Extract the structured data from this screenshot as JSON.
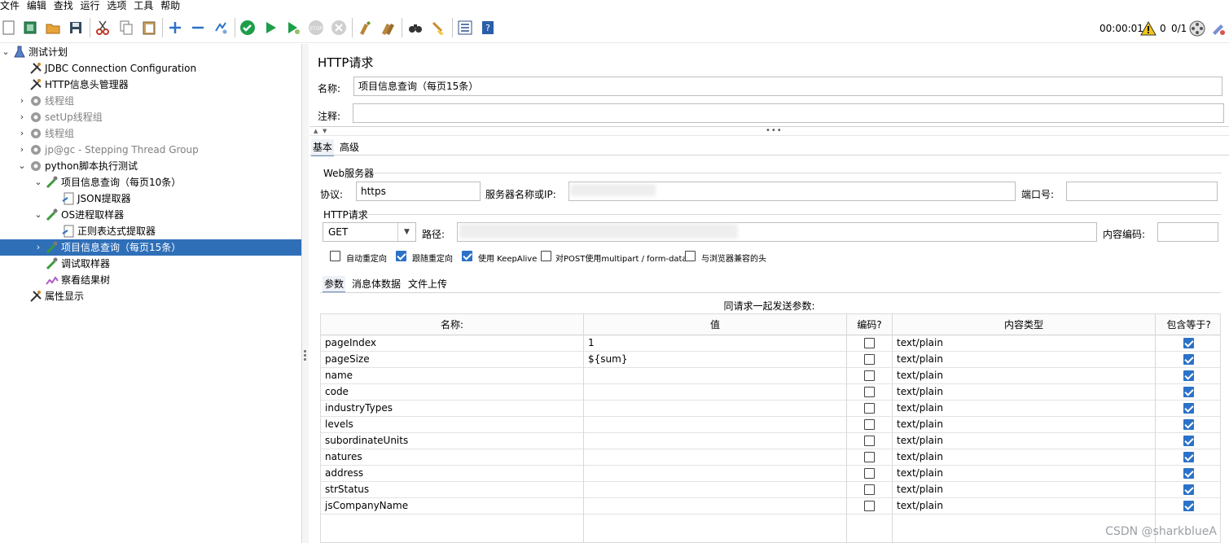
{
  "menu": [
    "文件",
    "编辑",
    "查找",
    "运行",
    "选项",
    "工具",
    "帮助"
  ],
  "toolbar": {
    "icons": [
      "new-icon",
      "templates-icon",
      "open-icon",
      "save-icon",
      "cut-icon",
      "copy-icon",
      "paste-icon",
      "expand-icon",
      "collapse-icon",
      "toggle-icon",
      "start-icon",
      "start-no-pause-icon",
      "stop-icon",
      "shutdown-icon",
      "clear-icon",
      "clear-all-icon",
      "search-icon",
      "reset-search-icon",
      "function-helper-icon",
      "help-icon"
    ],
    "timer": "00:00:01",
    "warnings": "0",
    "threads": "0/1"
  },
  "tree": [
    {
      "label": "测试计划",
      "icon": "test-plan-icon",
      "expanded": true,
      "disabled": false,
      "selected": false
    },
    {
      "label": "JDBC Connection Configuration",
      "icon": "config-icon",
      "disabled": false,
      "selected": false
    },
    {
      "label": "HTTP信息头管理器",
      "icon": "config-icon",
      "disabled": false,
      "selected": false
    },
    {
      "label": "线程组",
      "icon": "thread-group-icon",
      "disabled": true,
      "selected": false
    },
    {
      "label": "setUp线程组",
      "icon": "thread-group-icon",
      "disabled": true,
      "selected": false
    },
    {
      "label": "线程组",
      "icon": "thread-group-icon",
      "disabled": true,
      "selected": false
    },
    {
      "label": "jp@gc - Stepping Thread Group",
      "icon": "thread-group-icon",
      "disabled": true,
      "selected": false
    },
    {
      "label": "python脚本执行测试",
      "icon": "thread-group-icon",
      "disabled": false,
      "selected": false
    },
    {
      "label": "项目信息查询（每页10条）",
      "icon": "sampler-icon",
      "disabled": false,
      "selected": false
    },
    {
      "label": "JSON提取器",
      "icon": "extractor-icon",
      "disabled": false,
      "selected": false
    },
    {
      "label": "OS进程取样器",
      "icon": "sampler-icon",
      "disabled": false,
      "selected": false
    },
    {
      "label": "正则表达式提取器",
      "icon": "extractor-icon",
      "disabled": false,
      "selected": false
    },
    {
      "label": "项目信息查询（每页15条）",
      "icon": "sampler-icon",
      "disabled": false,
      "selected": true
    },
    {
      "label": "调试取样器",
      "icon": "sampler-icon",
      "disabled": false,
      "selected": false
    },
    {
      "label": "察看结果树",
      "icon": "listener-icon",
      "disabled": false,
      "selected": false
    },
    {
      "label": "属性显示",
      "icon": "config-icon",
      "disabled": false,
      "selected": false
    }
  ],
  "panel": {
    "title": "HTTP请求",
    "name_label": "名称:",
    "name_value": "项目信息查询（每页15条）",
    "comment_label": "注释:",
    "comment_value": "",
    "tabs": [
      "基本",
      "高级"
    ],
    "web_server": {
      "title": "Web服务器",
      "protocol_label": "协议:",
      "protocol_value": "https",
      "server_label": "服务器名称或IP:",
      "port_label": "端口号:",
      "port_value": ""
    },
    "http_request": {
      "title": "HTTP请求",
      "method": "GET",
      "path_label": "路径:",
      "encoding_label": "内容编码:",
      "encoding_value": ""
    },
    "options": [
      {
        "label": "自动重定向",
        "checked": false
      },
      {
        "label": "跟随重定向",
        "checked": true
      },
      {
        "label": "使用 KeepAlive",
        "checked": true
      },
      {
        "label": "对POST使用multipart / form-data",
        "checked": false
      },
      {
        "label": "与浏览器兼容的头",
        "checked": false
      }
    ],
    "subtabs": [
      "参数",
      "消息体数据",
      "文件上传"
    ],
    "params_caption": "同请求一起发送参数:",
    "columns": [
      "名称:",
      "值",
      "编码?",
      "内容类型",
      "包含等于?"
    ],
    "params": [
      {
        "name": "pageIndex",
        "value": "1",
        "encode": false,
        "type": "text/plain",
        "include_equals": true
      },
      {
        "name": "pageSize",
        "value": "${sum}",
        "encode": false,
        "type": "text/plain",
        "include_equals": true
      },
      {
        "name": "name",
        "value": "",
        "encode": false,
        "type": "text/plain",
        "include_equals": true
      },
      {
        "name": "code",
        "value": "",
        "encode": false,
        "type": "text/plain",
        "include_equals": true
      },
      {
        "name": "industryTypes",
        "value": "",
        "encode": false,
        "type": "text/plain",
        "include_equals": true
      },
      {
        "name": "levels",
        "value": "",
        "encode": false,
        "type": "text/plain",
        "include_equals": true
      },
      {
        "name": "subordinateUnits",
        "value": "",
        "encode": false,
        "type": "text/plain",
        "include_equals": true
      },
      {
        "name": "natures",
        "value": "",
        "encode": false,
        "type": "text/plain",
        "include_equals": true
      },
      {
        "name": "address",
        "value": "",
        "encode": false,
        "type": "text/plain",
        "include_equals": true
      },
      {
        "name": "strStatus",
        "value": "",
        "encode": false,
        "type": "text/plain",
        "include_equals": true
      },
      {
        "name": "jsCompanyName",
        "value": "",
        "encode": false,
        "type": "text/plain",
        "include_equals": true
      }
    ]
  },
  "watermark": "CSDN @sharkblueA"
}
